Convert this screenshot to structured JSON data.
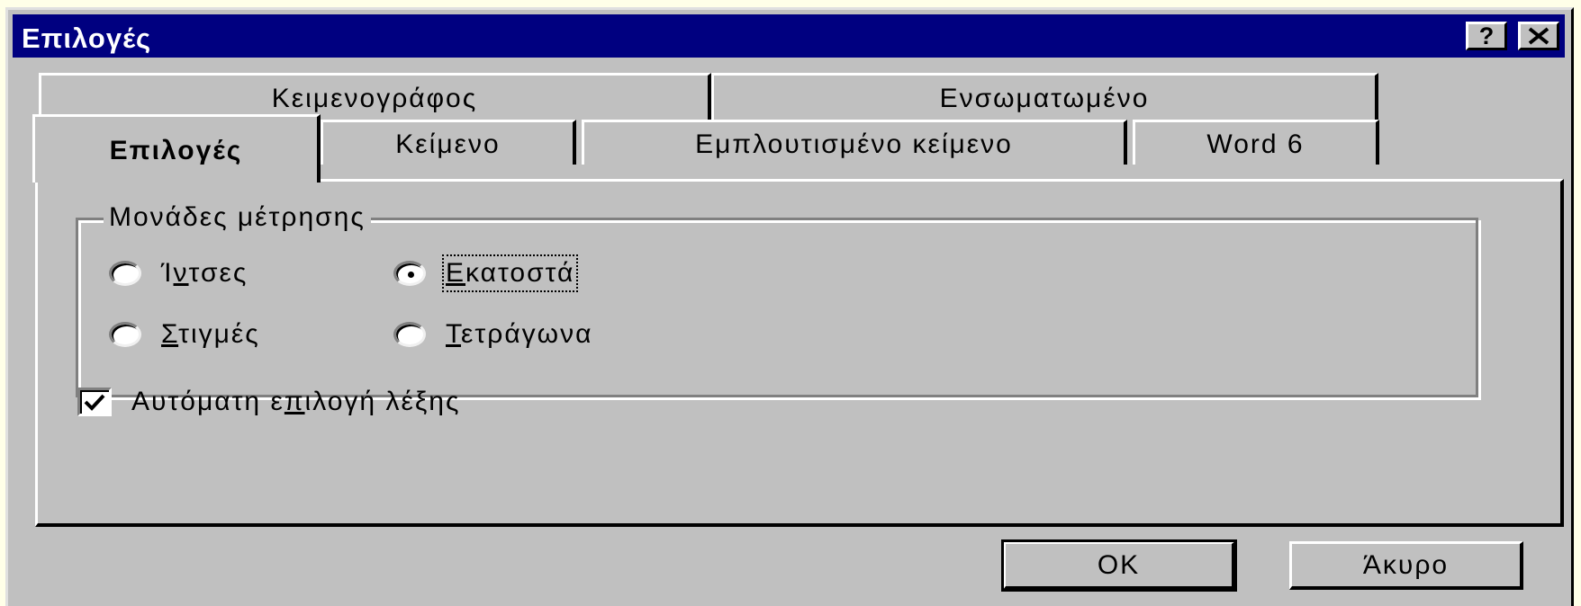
{
  "window": {
    "title": "Επιλογές"
  },
  "titlebar_buttons": {
    "help_label": "?",
    "close_icon": "close-icon"
  },
  "tabs_back": [
    {
      "label": "Κειμενογράφος"
    },
    {
      "label": "Ενσωματωμένο"
    }
  ],
  "tabs_front": [
    {
      "label": "Επιλογές",
      "active": true
    },
    {
      "label": "Κείμενο"
    },
    {
      "label": "Εμπλουτισμένο κείμενο"
    },
    {
      "label": "Word 6"
    }
  ],
  "units_group": {
    "legend": "Μονάδες μέτρησης",
    "options": [
      {
        "pre": "Ί",
        "u": "ν",
        "post": "τσες",
        "selected": false
      },
      {
        "pre": "",
        "u": "Ε",
        "post": "κατοστά",
        "selected": true
      },
      {
        "pre": "",
        "u": "Σ",
        "post": "τιγμές",
        "selected": false
      },
      {
        "pre": "",
        "u": "Τ",
        "post": "ετράγωνα",
        "selected": false
      }
    ]
  },
  "auto_select": {
    "pre": "Αυτόματη ε",
    "u": "π",
    "post": "ιλογή λέξης",
    "checked": true
  },
  "buttons": {
    "ok": "OK",
    "cancel": "Άκυρο"
  }
}
